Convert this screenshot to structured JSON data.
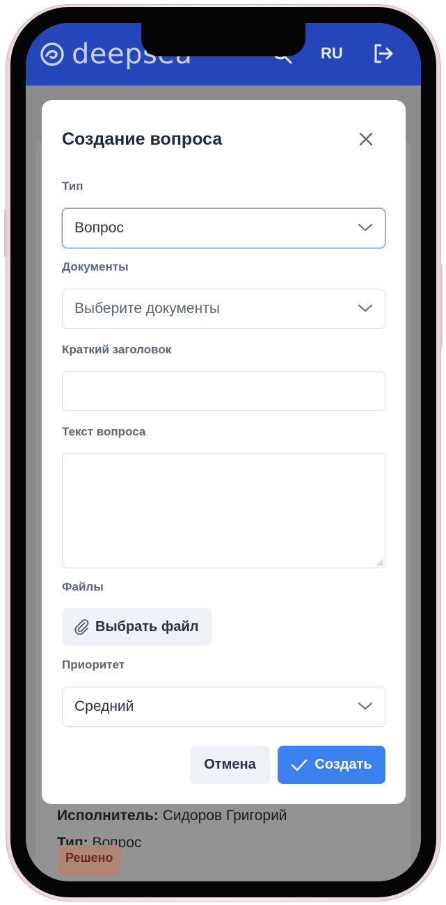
{
  "header": {
    "logo_text": "deepsea",
    "language": "RU"
  },
  "background": {
    "executor_label": "Исполнитель:",
    "executor_value": " Сидоров Григорий",
    "type_label": "Тип:",
    "type_value": " Вопрос",
    "status_badge": "Решено"
  },
  "modal": {
    "title": "Создание вопроса",
    "type_label": "Тип",
    "type_value": "Вопрос",
    "documents_label": "Документы",
    "documents_placeholder": "Выберите документы",
    "short_title_label": "Краткий заголовок",
    "short_title_value": "",
    "question_text_label": "Текст вопроса",
    "question_text_value": "",
    "files_label": "Файлы",
    "choose_file_label": "Выбрать файл",
    "priority_label": "Приоритет",
    "priority_value": "Средний",
    "cancel_label": "Отмена",
    "create_label": "Создать"
  },
  "icons": {
    "logo": "deepsea-logo-icon",
    "search": "search-icon",
    "logout": "logout-icon",
    "close": "close-icon",
    "chevron": "chevron-down-icon",
    "paperclip": "paperclip-icon",
    "check": "check-icon"
  },
  "colors": {
    "header": "#2446b8",
    "primary_button": "#3b82f0",
    "overlay": "#8b8b8b",
    "badge": "#b08578"
  }
}
